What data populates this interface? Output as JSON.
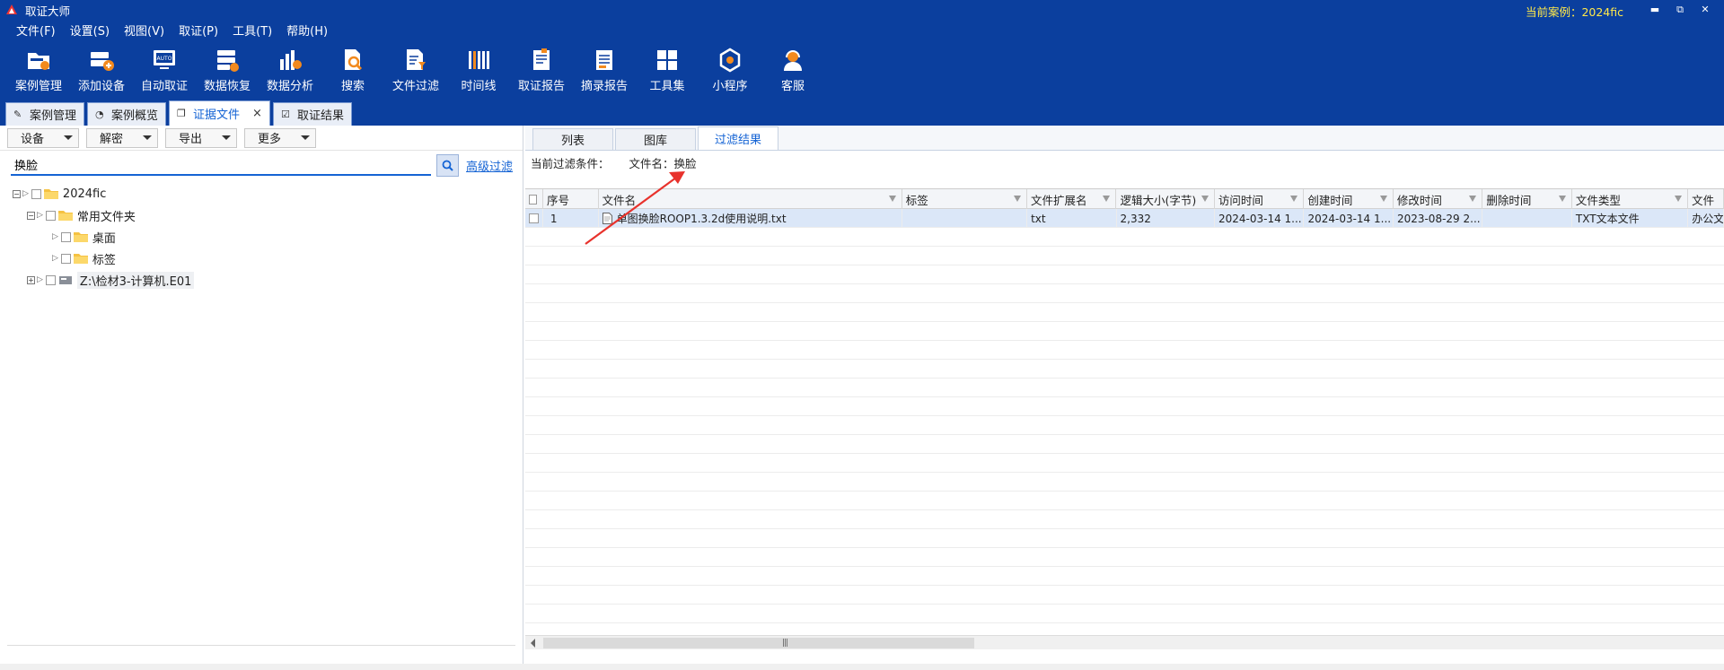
{
  "window": {
    "title": "取证大师",
    "current_case": "当前案例：2024fic",
    "minimize": "▬",
    "restore": "⧉",
    "close": "✕"
  },
  "menu": [
    "文件(F)",
    "设置(S)",
    "视图(V)",
    "取证(P)",
    "工具(T)",
    "帮助(H)"
  ],
  "toolbar": [
    {
      "label": "案例管理",
      "icon": "case-folder-icon"
    },
    {
      "label": "添加设备",
      "icon": "add-device-icon"
    },
    {
      "label": "自动取证",
      "icon": "auto-monitor-icon"
    },
    {
      "label": "数据恢复",
      "icon": "recover-icon"
    },
    {
      "label": "数据分析",
      "icon": "chart-icon"
    },
    {
      "label": "搜索",
      "icon": "search-doc-icon"
    },
    {
      "label": "文件过滤",
      "icon": "filter-doc-icon"
    },
    {
      "label": "时间线",
      "icon": "timeline-icon"
    },
    {
      "label": "取证报告",
      "icon": "report-icon"
    },
    {
      "label": "摘录报告",
      "icon": "excerpt-icon"
    },
    {
      "label": "工具集",
      "icon": "grid-icon"
    },
    {
      "label": "小程序",
      "icon": "miniapp-icon"
    },
    {
      "label": "客服",
      "icon": "support-icon"
    }
  ],
  "tabs": [
    {
      "label": "案例管理",
      "active": false
    },
    {
      "label": "案例概览",
      "active": false
    },
    {
      "label": "证据文件",
      "active": true,
      "close": "×"
    },
    {
      "label": "取证结果",
      "active": false
    }
  ],
  "left": {
    "buttons": [
      "设备",
      "解密",
      "导出",
      "更多"
    ],
    "search_value": "换脸",
    "advanced_filter": "高级过滤",
    "tree": [
      {
        "label": "2024fic",
        "level": 0,
        "type": "folder",
        "expander": "−"
      },
      {
        "label": "常用文件夹",
        "level": 1,
        "type": "folder",
        "expander": "−"
      },
      {
        "label": "桌面",
        "level": 2,
        "type": "folder",
        "expander": ""
      },
      {
        "label": "标签",
        "level": 2,
        "type": "folder",
        "expander": ""
      },
      {
        "label": "Z:\\检材3-计算机.E01",
        "level": 1,
        "type": "disk",
        "expander": "+"
      }
    ]
  },
  "right": {
    "tabs": [
      {
        "label": "列表",
        "active": false
      },
      {
        "label": "图库",
        "active": false
      },
      {
        "label": "过滤结果",
        "active": true
      }
    ],
    "filter_label": "当前过滤条件：",
    "filter_value": "文件名：换脸",
    "columns": [
      "序号",
      "文件名",
      "标签",
      "文件扩展名",
      "逻辑大小(字节)",
      "访问时间",
      "创建时间",
      "修改时间",
      "删除时间",
      "文件类型",
      "文件"
    ],
    "rows": [
      {
        "idx": "1",
        "name": "单图换脸ROOP1.3.2d使用说明.txt",
        "tag": "",
        "ext": "txt",
        "size": "2,332",
        "atime": "2024-03-14 1...",
        "ctime": "2024-03-14 1...",
        "mtime": "2023-08-29 2...",
        "dtime": "",
        "ftype": "TXT文本文件",
        "extra": "办公文"
      }
    ]
  },
  "colors": {
    "brand": "#0b3f9e",
    "accent": "#1463d4",
    "case_text": "#ffe84a",
    "arrow": "#e8322c"
  }
}
